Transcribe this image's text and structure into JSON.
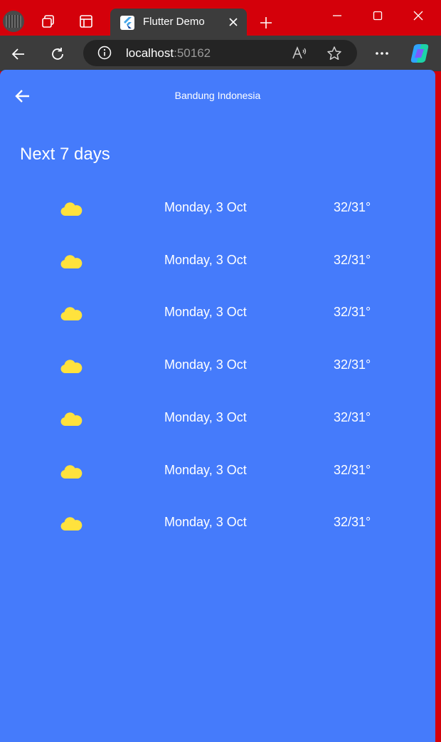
{
  "browser": {
    "tab_title": "Flutter Demo",
    "url_host": "localhost",
    "url_port": ":50162"
  },
  "app": {
    "location": "Bandung Indonesia",
    "section_title": "Next 7 days",
    "days": [
      {
        "date": "Monday, 3 Oct",
        "temp": "32/31°",
        "icon": "cloud-icon"
      },
      {
        "date": "Monday, 3 Oct",
        "temp": "32/31°",
        "icon": "cloud-icon"
      },
      {
        "date": "Monday, 3 Oct",
        "temp": "32/31°",
        "icon": "cloud-icon"
      },
      {
        "date": "Monday, 3 Oct",
        "temp": "32/31°",
        "icon": "cloud-icon"
      },
      {
        "date": "Monday, 3 Oct",
        "temp": "32/31°",
        "icon": "cloud-icon"
      },
      {
        "date": "Monday, 3 Oct",
        "temp": "32/31°",
        "icon": "cloud-icon"
      },
      {
        "date": "Monday, 3 Oct",
        "temp": "32/31°",
        "icon": "cloud-icon"
      }
    ]
  },
  "colors": {
    "titlebar": "#d4000a",
    "toolbar": "#3c3c3c",
    "app_background": "#457bfb",
    "cloud": "#ffe23d"
  }
}
